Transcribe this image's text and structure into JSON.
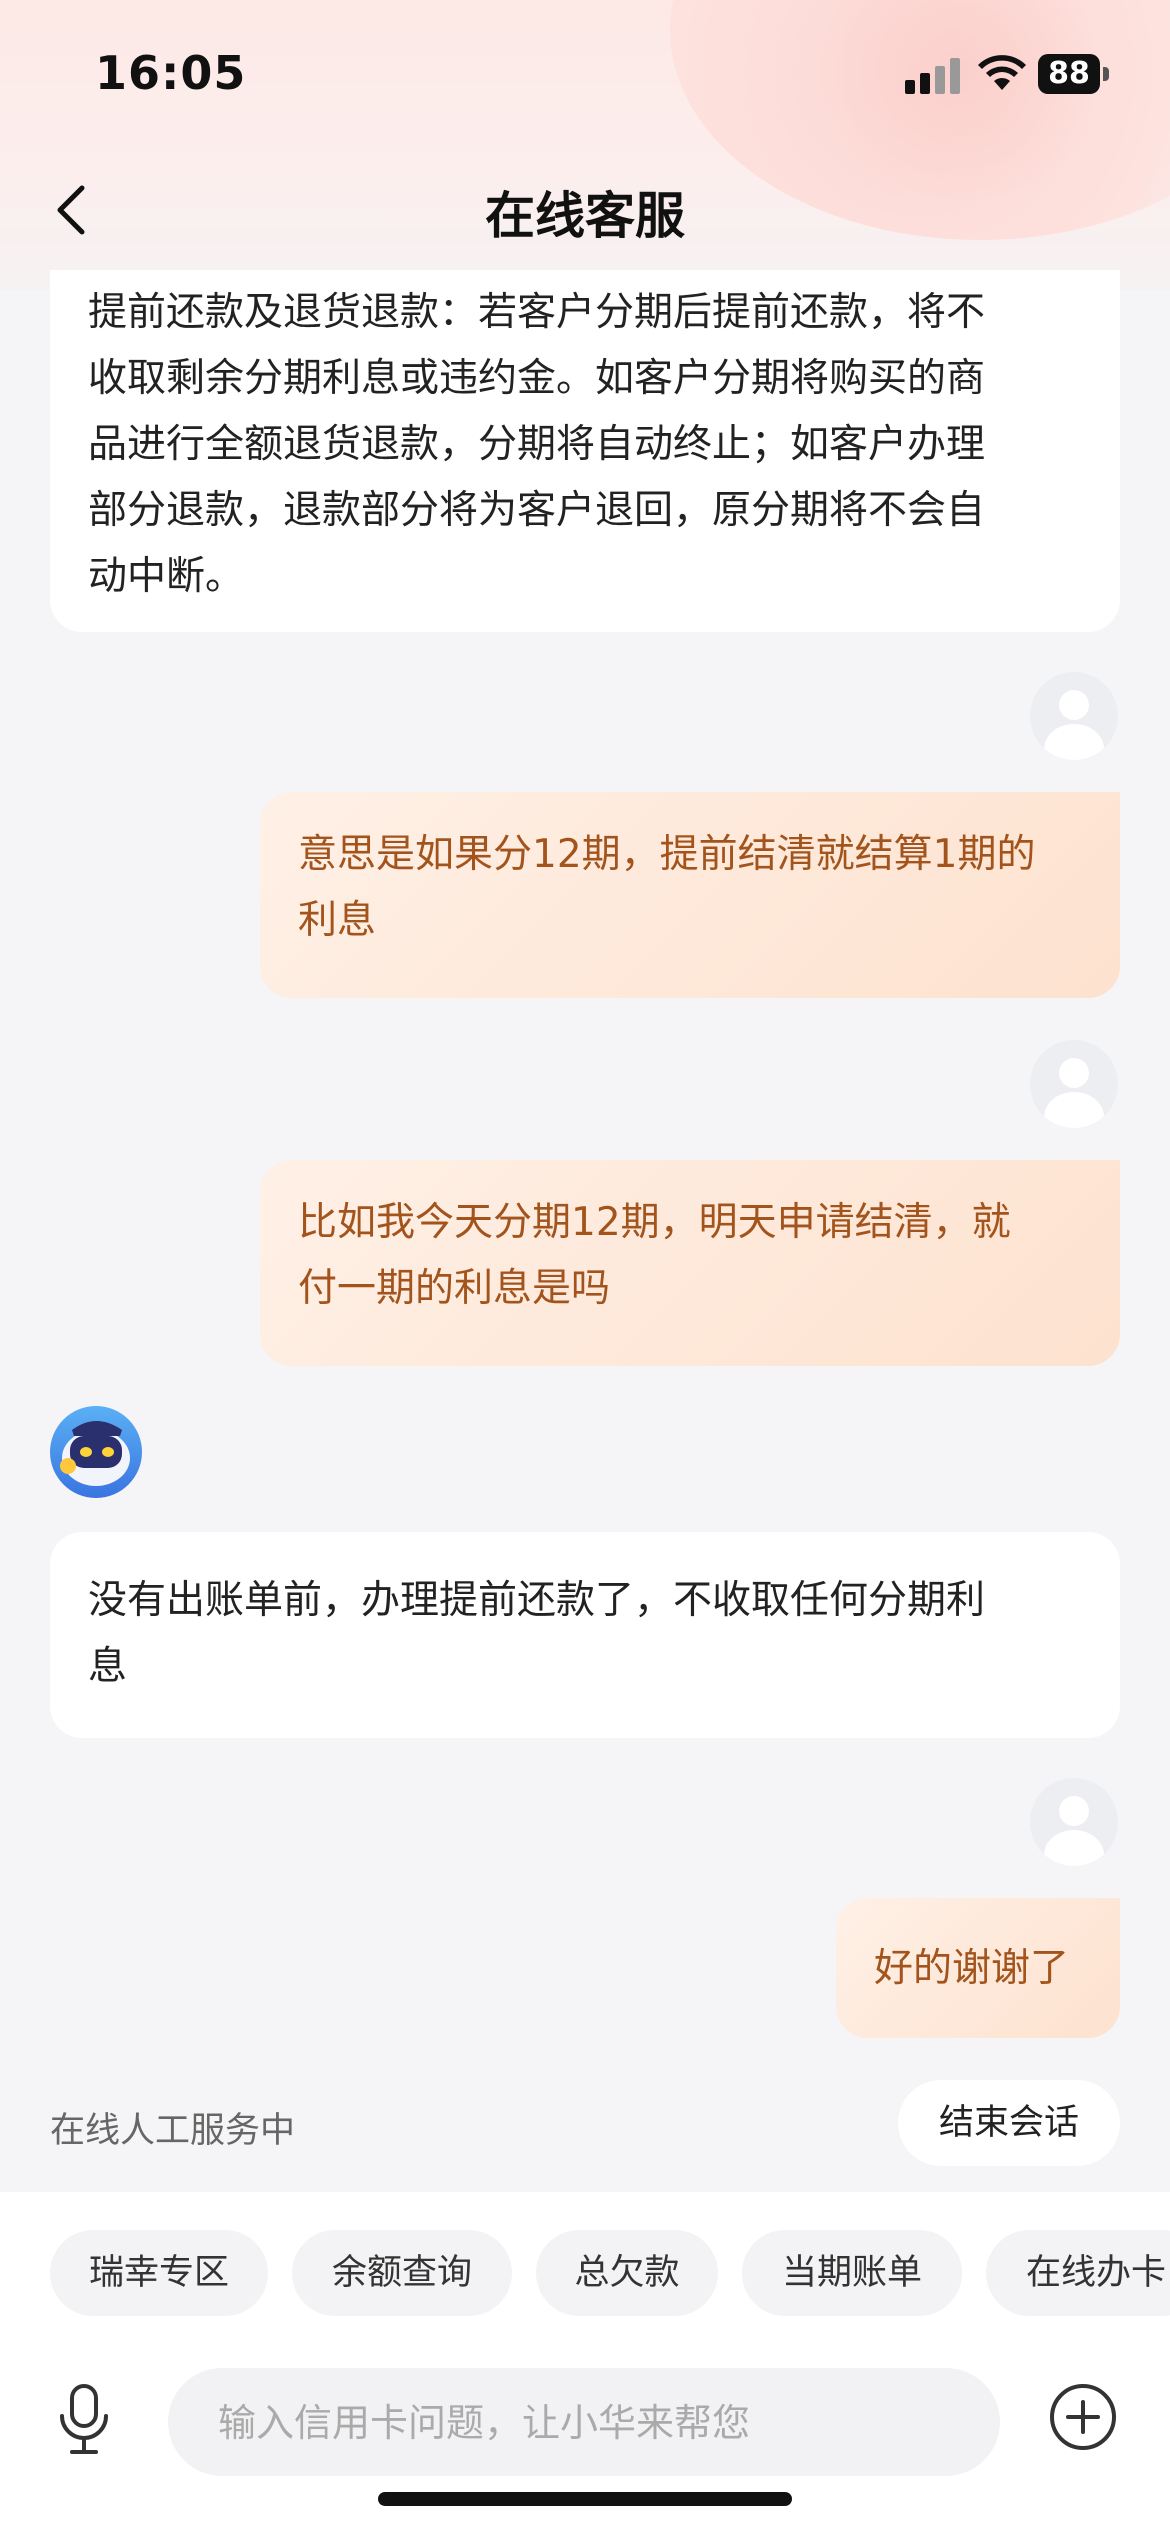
{
  "status_bar": {
    "time": "16:05",
    "battery": "88"
  },
  "nav": {
    "title": "在线客服"
  },
  "messages": {
    "m0_lines": [
      "提前还款及退货退款：若客户分期后提前还款，将不",
      "收取剩余分期利息或违约金。如客户分期将购买的商",
      "品进行全额退货退款，分期将自动终止；如客户办理",
      "部分退款，退款部分将为客户退回，原分期将不会自",
      "动中断。"
    ],
    "m1_lines": [
      "意思是如果分12期，提前结清就结算1期的",
      "利息"
    ],
    "m2_lines": [
      "比如我今天分期12期，明天申请结清，就",
      "付一期的利息是吗"
    ],
    "m3_lines": [
      "没有出账单前，办理提前还款了，不收取任何分期利",
      "息"
    ],
    "m4_lines": [
      "好的谢谢了"
    ]
  },
  "service": {
    "status_text": "在线人工服务中",
    "end_button": "结束会话"
  },
  "chips": [
    "瑞幸专区",
    "余额查询",
    "总欠款",
    "当期账单",
    "在线办卡"
  ],
  "input": {
    "placeholder": "输入信用卡问题，让小华来帮您"
  },
  "icons": {
    "back": "chevron-left-icon",
    "mic": "microphone-icon",
    "plus": "plus-circle-icon"
  },
  "colors": {
    "user_text": "#a3541d",
    "user_bubble": "#fde2cf",
    "background": "#f5f5f7"
  }
}
